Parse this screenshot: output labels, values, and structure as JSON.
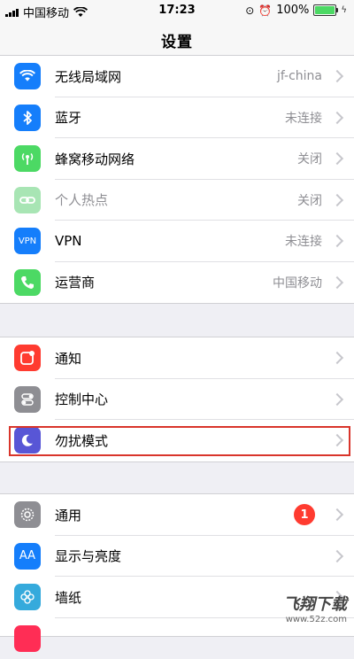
{
  "status": {
    "carrier": "中国移动",
    "time": "17:23",
    "battery": "100%"
  },
  "nav": {
    "title": "设置"
  },
  "group1": [
    {
      "icon": "wifi-icon",
      "label": "无线局域网",
      "value": "jf-china",
      "color": "#157efb"
    },
    {
      "icon": "bluetooth-icon",
      "label": "蓝牙",
      "value": "未连接",
      "color": "#157efb"
    },
    {
      "icon": "cellular-icon",
      "label": "蜂窝移动网络",
      "value": "关闭",
      "color": "#4cd964"
    },
    {
      "icon": "hotspot-icon",
      "label": "个人热点",
      "value": "关闭",
      "color": "#a8e5b4"
    },
    {
      "icon": "vpn-icon",
      "label": "VPN",
      "value": "未连接",
      "color": "#157efb",
      "icon_text": "VPN"
    },
    {
      "icon": "phone-icon",
      "label": "运营商",
      "value": "中国移动",
      "color": "#4cd964"
    }
  ],
  "group2": [
    {
      "icon": "notifications-icon",
      "label": "通知",
      "color": "#ff3b30"
    },
    {
      "icon": "control-center-icon",
      "label": "控制中心",
      "color": "#8e8e93"
    },
    {
      "icon": "do-not-disturb-icon",
      "label": "勿扰模式",
      "color": "#5856d6"
    }
  ],
  "group3": [
    {
      "icon": "gear-icon",
      "label": "通用",
      "badge": "1",
      "color": "#8e8e93"
    },
    {
      "icon": "display-icon",
      "label": "显示与亮度",
      "color": "#157efb",
      "icon_text": "AA"
    },
    {
      "icon": "wallpaper-icon",
      "label": "墙纸",
      "color": "#35aadc"
    }
  ],
  "watermark": {
    "line1": "飞翔下载",
    "line2": "www.52z.com"
  }
}
